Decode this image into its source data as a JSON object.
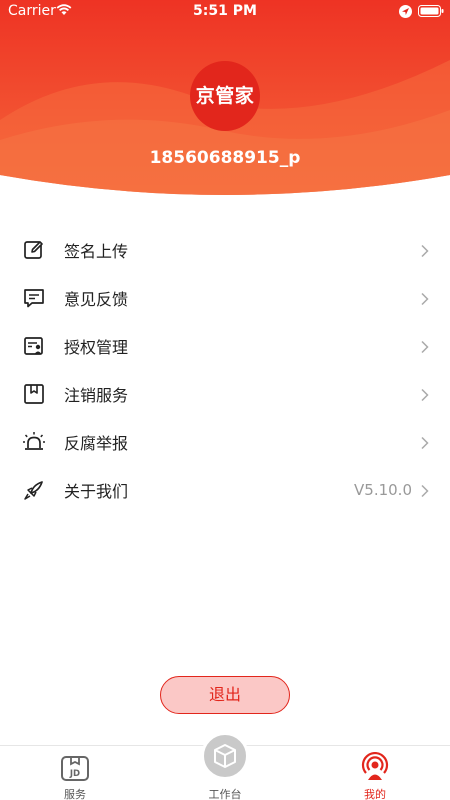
{
  "status_bar": {
    "carrier": "Carrier",
    "time": "5:51 PM"
  },
  "profile": {
    "logo_text": "京管家",
    "username": "18560688915_p"
  },
  "menu": [
    {
      "label": "签名上传",
      "icon": "edit-icon"
    },
    {
      "label": "意见反馈",
      "icon": "message-icon"
    },
    {
      "label": "授权管理",
      "icon": "authorization-icon"
    },
    {
      "label": "注销服务",
      "icon": "bookmark-icon"
    },
    {
      "label": "反腐举报",
      "icon": "alarm-icon"
    },
    {
      "label": "关于我们",
      "icon": "rocket-icon",
      "value": "V5.10.0"
    }
  ],
  "logout_label": "退出",
  "tabs": [
    {
      "label": "服务",
      "icon": "jd-package-icon",
      "active": false
    },
    {
      "label": "工作台",
      "icon": "box-icon",
      "active": false
    },
    {
      "label": "我的",
      "icon": "profile-broadcast-icon",
      "active": true
    }
  ],
  "colors": {
    "accent": "#e2261c",
    "header_gradient_top": "#ee3324",
    "header_gradient_bottom": "#f46d3c"
  }
}
